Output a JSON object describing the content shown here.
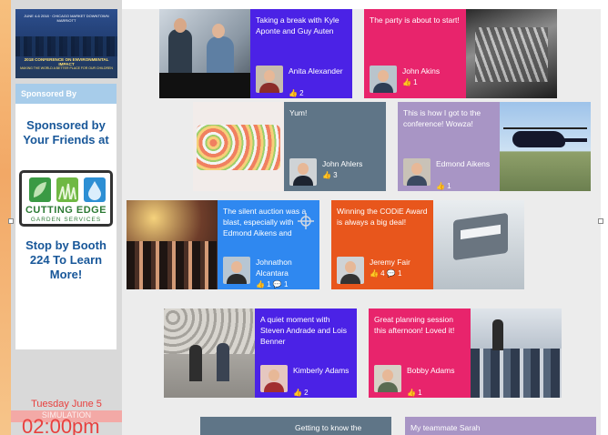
{
  "colors": {
    "blue": "#3a6ef5",
    "pink": "#e8246c",
    "gray": "#5f7587",
    "purple": "#4b22e6",
    "lilac": "#a895c5",
    "orange": "#e8561c",
    "sky": "#2f88f0"
  },
  "sidebar": {
    "banner": {
      "date_line": "JUNE 4-6 2018 · CHICAGO MARKET DOWNTOWN MARRIOTT",
      "title": "2018 CONFERENCE ON ENVIRONMENTAL IMPACT",
      "subtitle": "MAKING THE WORLD A BETTER PLACE FOR OUR CHILDREN"
    },
    "sponsor": {
      "header": "Sponsored By",
      "line1": "Sponsored by Your Friends at",
      "logo_name": "CUTTING EDGE",
      "logo_sub": "GARDEN SERVICES",
      "line2": "Stop by Booth 224 To Learn More!"
    },
    "simulation": {
      "day": "Tuesday June 5",
      "label": "SIMULATION",
      "time": "02:00pm"
    }
  },
  "posts": [
    {
      "caption": "Taking a break with Kyle Aponte and Guy Auten",
      "author": "Anita Alexander",
      "stats": "👍 2",
      "avatar_icon": "user-avatar-icon"
    },
    {
      "caption": "The party is about to start!",
      "author": "John Akins",
      "stats": "👍 1",
      "avatar_icon": "user-avatar-icon"
    },
    {
      "caption": "Yum!",
      "author": "John Ahlers",
      "stats": "👍 3",
      "avatar_icon": "user-avatar-icon"
    },
    {
      "caption": "This is how I got to the conference! Wowza!",
      "author": "Edmond Aikens",
      "stats": "👍 1",
      "avatar_icon": "user-avatar-icon"
    },
    {
      "caption": "The silent auction was a blast, especially with Edmond Aikens and",
      "author": "Johnathon Alcantara",
      "stats": "👍 1 💬 1",
      "avatar_icon": "user-avatar-icon"
    },
    {
      "caption": "Winning the CODiE Award is always a big deal!",
      "author": "Jeremy Fair",
      "stats": "👍 4 💬 1",
      "avatar_icon": "user-avatar-icon"
    },
    {
      "caption": "A quiet moment with Steven Andrade and Lois Benner",
      "author": "Kimberly Adams",
      "stats": "👍 2",
      "avatar_icon": "user-avatar-icon"
    },
    {
      "caption": "Great planning session this afternoon! Loved it!",
      "author": "Bobby Adams",
      "stats": "👍 1",
      "avatar_icon": "user-avatar-icon"
    },
    {
      "caption": "Getting to know the"
    },
    {
      "caption": "My teammate Sarah"
    }
  ]
}
